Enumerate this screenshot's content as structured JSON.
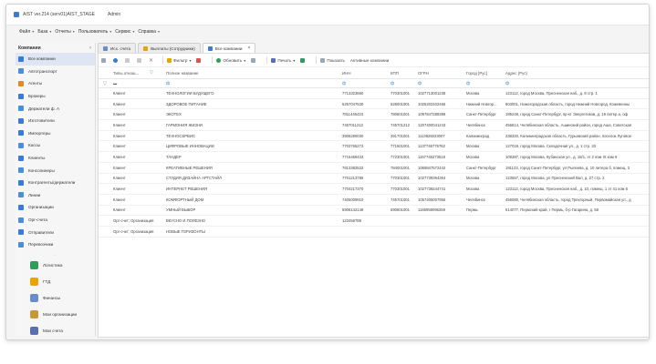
{
  "window": {
    "title": "AIST ver.214 (serv01)AIST_STAGE",
    "user": "Admin"
  },
  "menu": [
    {
      "label": "Файл"
    },
    {
      "label": "База"
    },
    {
      "label": "Отчеты"
    },
    {
      "label": "Пользователь"
    },
    {
      "label": "Сервис"
    },
    {
      "label": "Справка"
    }
  ],
  "sidebar": {
    "title": "Компании",
    "collapse_icon": "chevron-left-icon",
    "items": [
      {
        "label": "Все компании",
        "color": "#3a7bd5"
      },
      {
        "label": "Автотранспорт",
        "color": "#4a90d9"
      },
      {
        "label": "Агенты",
        "color": "#e08a2a"
      },
      {
        "label": "Брокеры",
        "color": "#3a7bd5"
      },
      {
        "label": "Держатели ф. А",
        "color": "#4a90d9"
      },
      {
        "label": "Изготовители",
        "color": "#3a7bd5"
      },
      {
        "label": "Импортеры",
        "color": "#3a7bd5"
      },
      {
        "label": "Кассы",
        "color": "#4a90d9"
      },
      {
        "label": "Клиенты",
        "color": "#3a7bd5"
      },
      {
        "label": "Консолинеры",
        "color": "#4a90d9"
      },
      {
        "label": "Контрагенты/держатели",
        "color": "#3a7bd5"
      },
      {
        "label": "Линии",
        "color": "#4a90d9"
      },
      {
        "label": "Организации",
        "color": "#3a7bd5"
      },
      {
        "label": "Орг-счета",
        "color": "#4a90d9"
      },
      {
        "label": "Отправители",
        "color": "#3a7bd5"
      },
      {
        "label": "Перевозчики",
        "color": "#4a90d9"
      }
    ],
    "separator": "...",
    "sections": [
      {
        "label": "Логистика",
        "color": "#2e9e5b"
      },
      {
        "label": "ГТД",
        "color": "#e8a400"
      },
      {
        "label": "Финансы",
        "color": "#6a8ccf"
      },
      {
        "label": "Мои организации",
        "color": "#c9963a"
      },
      {
        "label": "Мои счета",
        "color": "#5a6fb0"
      }
    ]
  },
  "tabs": [
    {
      "label": "Исх. счета",
      "active": false
    },
    {
      "label": "Выплаты (Сотрудники)",
      "active": false
    },
    {
      "label": "Все компании",
      "active": true
    }
  ],
  "toolbar": {
    "filter_label": "Фильтр",
    "refresh_label": "Обновить",
    "print_label": "Печать",
    "show_label": "Показать",
    "active_label": "Активные компании"
  },
  "table": {
    "columns": [
      "Типы отнош...",
      "Полное название",
      "ИНН",
      "КПП",
      "ОГРН",
      "Город [Рус]",
      "Адрес (Рус)"
    ],
    "rows": [
      [
        "Клиент",
        "ТЕХНОЛОГИИ БУДУЩЕГО",
        "7713323660",
        "770301001",
        "1027713001238",
        "Москва",
        "123112, город Москва, Пресненская наб., д. 8 стр. 1"
      ],
      [
        "Клиент",
        "ЗДОРОВОЕ ПИТАНИЕ",
        "5257047530",
        "526001001",
        "1025202402466",
        "Нижний Новгор...",
        "603001, Нижегородская область, город Нижний Новгород, Кожевенны"
      ],
      [
        "Клиент",
        "ЭКОТЕХ",
        "7811446423",
        "780601001",
        "1097847288398",
        "Санкт-Петербург",
        "195248, город Санкт-Петербург, пр-кт Энергетиков, д. 19 литер а, оф"
      ],
      [
        "Клиент",
        "ГАРМОНИЯ ЖИЗНИ",
        "7457011212",
        "745701212",
        "1207400041243",
        "Челябинск",
        "456614, Челябинская область, Ашинский район, город Аша, Советская"
      ],
      [
        "Клиент",
        "ТЕХНОСЕРВИС",
        "3906290030",
        "391701001",
        "1113926023007",
        "Калининград",
        "238320, Калининградская область, Гурьевский район, поселок Луговое"
      ],
      [
        "Клиент",
        "ЦИФРОВЫЕ ИННОВАЦИИ",
        "7703765272",
        "771501001",
        "1137746776762",
        "Москва",
        "127018, город Москва, Складочная ул., д. 1 стр. 33"
      ],
      [
        "Клиент",
        "ТАНДЕР",
        "7715458433",
        "772301001",
        "1157746273618",
        "Москва",
        "109387, город Москва, Кубанская ул., д. 18/1, эт 2 пом IX ком 9"
      ],
      [
        "Клиент",
        "КРЕАТИВНЫЕ РЕШЕНИЯ",
        "7813383532",
        "784001001",
        "1069847572442",
        "Санкт-Петербург",
        "191123, город Санкт-Петербург, ул Рылеева, д. 10 литера б, помещ. 3"
      ],
      [
        "Клиент",
        "СТУДИЯ ДИЗАЙНА АРТСТАЙЛ",
        "7701213786",
        "770301001",
        "1027739394364",
        "Москва",
        "123557, город Москва, ул Пресненский Вал, д. 27 стр. 2"
      ],
      [
        "Клиент",
        "ИНТЕРНЕТ РЕШЕНИЯ",
        "7704217370",
        "770301001",
        "1027739244741",
        "Москва",
        "123112, город Москва, Пресненская наб., д. 10, помещ. 1 эт 41 ком 6"
      ],
      [
        "Клиент",
        "КОМФОРТНЫЙ ДОМ",
        "7405009910",
        "745701001",
        "1057405007955",
        "Челябинск",
        "456080, Челябинская область, город Трехгорный, Первомайская ул., д"
      ],
      [
        "Клиент",
        "УМНЫЙ ВЫБОР",
        "5906142148",
        "590601001",
        "1165958096259",
        "Пермь",
        "614077, Пермский край, г Пермь, б-р Гагарина, д. 58"
      ],
      [
        "Орг-счет; Организация",
        "ВКУСНО И ПОЛЕЗНО",
        "123456789",
        "",
        "",
        "",
        ""
      ],
      [
        "Орг-счет; Организация",
        "НОВЫЕ ГОРИЗОНТЫ",
        "",
        "",
        "",
        "",
        ""
      ]
    ]
  },
  "colors": {
    "accent": "#3a7bd5",
    "selected_bg": "#dde6f2",
    "filter_icon": "#3b8fd8"
  }
}
